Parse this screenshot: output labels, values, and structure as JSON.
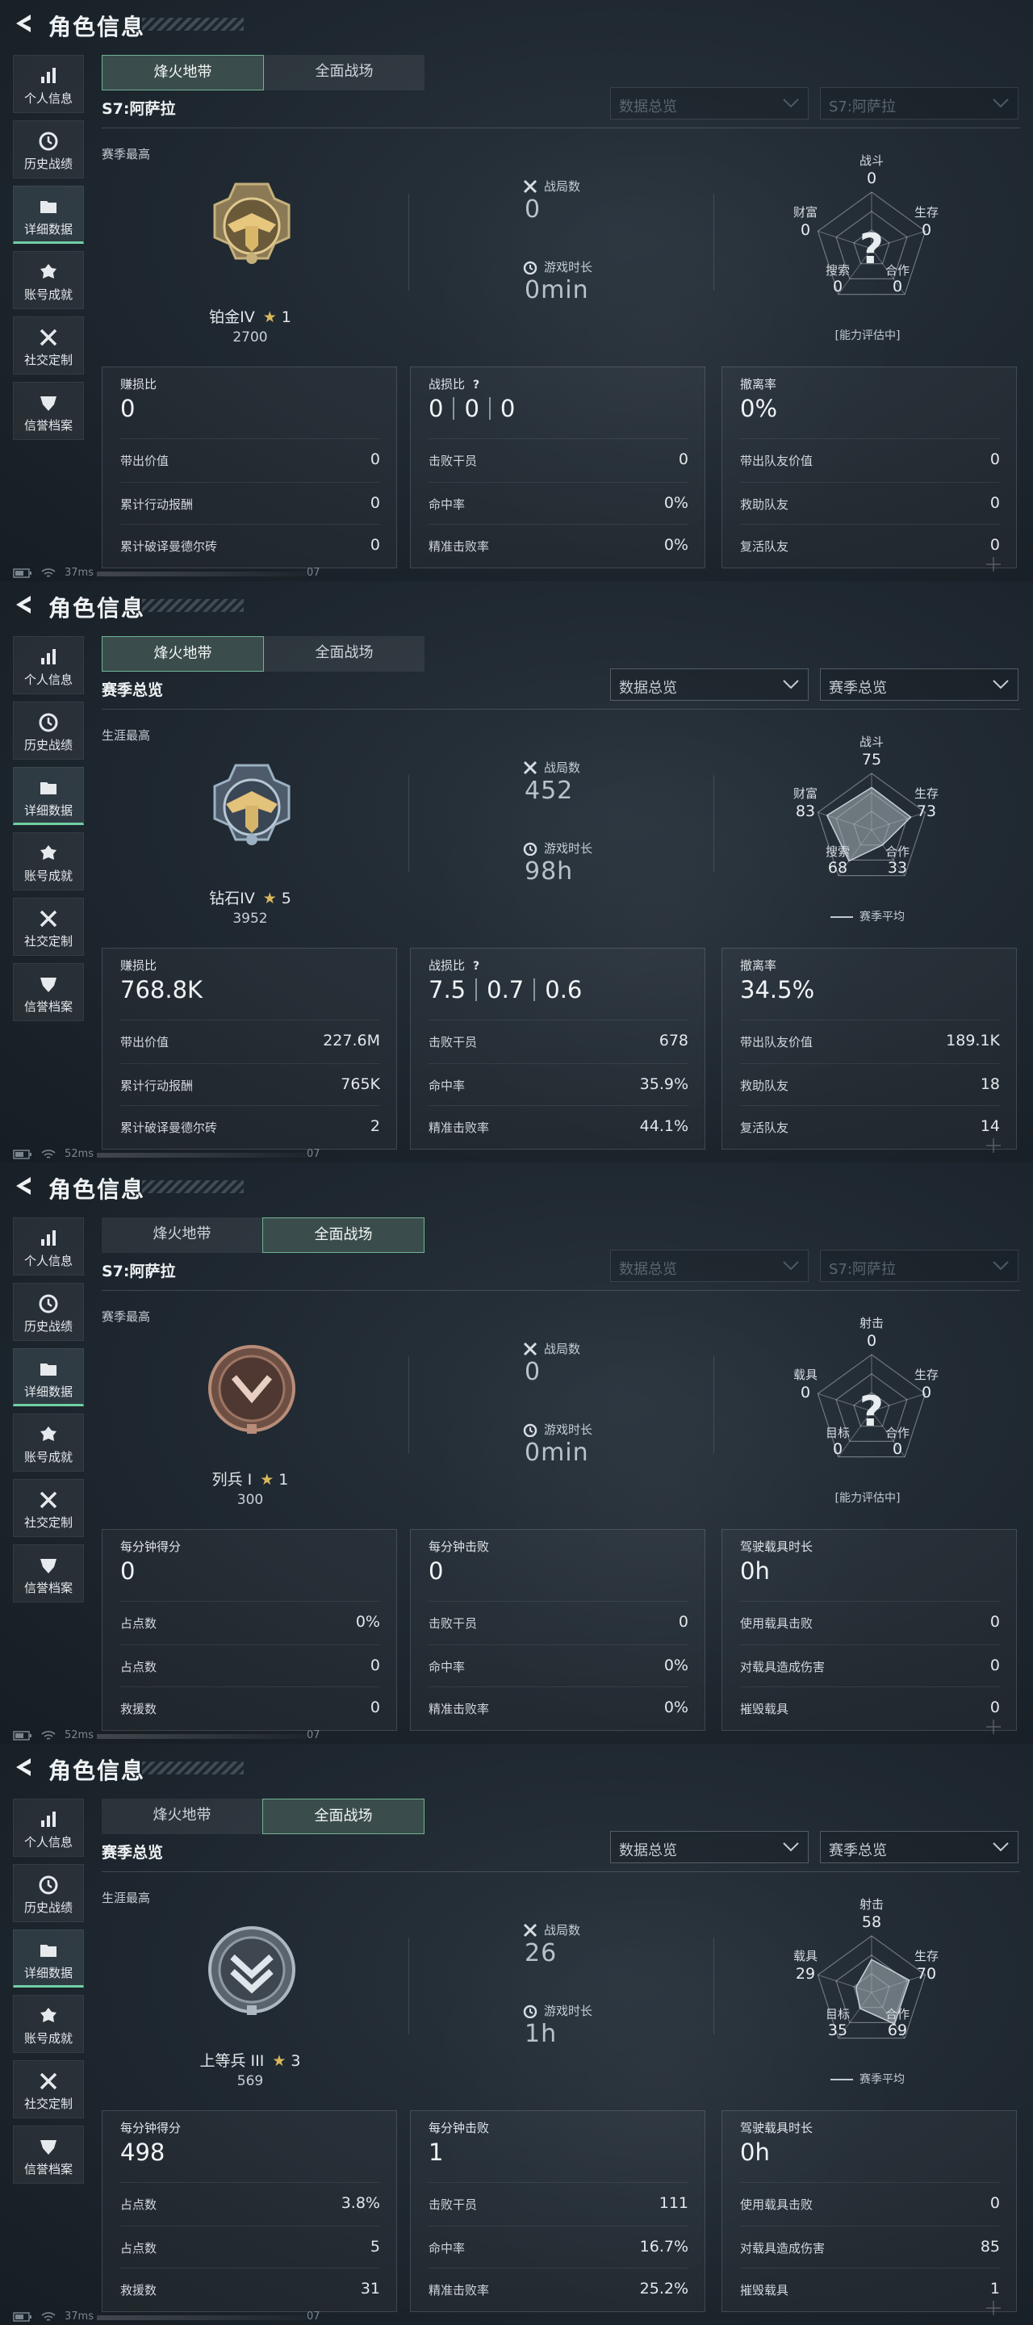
{
  "panels": [
    {
      "header_title": "角色信息",
      "sidebar": [
        "个人信息",
        "历史战绩",
        "详细数据",
        "账号成就",
        "社交定制",
        "信誉档案"
      ],
      "tabs": [
        "烽火地带",
        "全面战场"
      ],
      "active_tab": 0,
      "season_label": "S7:阿萨拉",
      "dropdowns": [
        "数据总览",
        "S7:阿萨拉"
      ],
      "dropdowns_dimmed": true,
      "best_label": "赛季最高",
      "rank_name": "铂金IV",
      "rank_stars": "1",
      "rank_score": "2700",
      "badge_type": "platinum-badge",
      "stat1_label": "战局数",
      "stat1_value": "0",
      "stat2_label": "游戏时长",
      "stat2_value": "0min",
      "radar": {
        "labels": [
          "战斗",
          "生存",
          "合作",
          "搜索",
          "财富"
        ],
        "values": [
          "0",
          "0",
          "0",
          "0",
          "0"
        ],
        "levels": [
          0,
          0,
          0,
          0,
          0
        ],
        "unknown": true,
        "note": "[能力评估中]"
      },
      "cards": [
        {
          "label": "赚损比",
          "value": "0",
          "rows": [
            [
              "带出价值",
              "0"
            ],
            [
              "累计行动报酬",
              "0"
            ],
            [
              "累计破译曼德尔砖",
              "0"
            ]
          ]
        },
        {
          "label": "战损比",
          "ratios": [
            "0",
            "0",
            "0"
          ],
          "help": "?",
          "rows": [
            [
              "击败干员",
              "0"
            ],
            [
              "命中率",
              "0%"
            ],
            [
              "精准击败率",
              "0%"
            ]
          ]
        },
        {
          "label": "撤离率",
          "value": "0%",
          "rows": [
            [
              "带出队友价值",
              "0"
            ],
            [
              "救助队友",
              "0"
            ],
            [
              "复活队友",
              "0"
            ]
          ]
        }
      ],
      "status_ping": "37ms",
      "status_page": "07"
    },
    {
      "header_title": "角色信息",
      "sidebar": [
        "个人信息",
        "历史战绩",
        "详细数据",
        "账号成就",
        "社交定制",
        "信誉档案"
      ],
      "tabs": [
        "烽火地带",
        "全面战场"
      ],
      "active_tab": 0,
      "season_label": "赛季总览",
      "dropdowns": [
        "数据总览",
        "赛季总览"
      ],
      "dropdowns_dimmed": false,
      "best_label": "生涯最高",
      "rank_name": "钻石IV",
      "rank_stars": "5",
      "rank_score": "3952",
      "badge_type": "diamond-badge",
      "stat1_label": "战局数",
      "stat1_value": "452",
      "stat2_label": "游戏时长",
      "stat2_value": "98h",
      "radar": {
        "labels": [
          "战斗",
          "生存",
          "合作",
          "搜索",
          "财富"
        ],
        "values": [
          "75",
          "73",
          "33",
          "68",
          "83"
        ],
        "levels": [
          0.75,
          0.73,
          0.33,
          0.68,
          0.83
        ],
        "unknown": false,
        "note": "赛季平均"
      },
      "cards": [
        {
          "label": "赚损比",
          "value": "768.8K",
          "rows": [
            [
              "带出价值",
              "227.6M"
            ],
            [
              "累计行动报酬",
              "765K"
            ],
            [
              "累计破译曼德尔砖",
              "2"
            ]
          ]
        },
        {
          "label": "战损比",
          "ratios": [
            "7.5",
            "0.7",
            "0.6"
          ],
          "help": "?",
          "rows": [
            [
              "击败干员",
              "678"
            ],
            [
              "命中率",
              "35.9%"
            ],
            [
              "精准击败率",
              "44.1%"
            ]
          ]
        },
        {
          "label": "撤离率",
          "value": "34.5%",
          "rows": [
            [
              "带出队友价值",
              "189.1K"
            ],
            [
              "救助队友",
              "18"
            ],
            [
              "复活队友",
              "14"
            ]
          ]
        }
      ],
      "status_ping": "52ms",
      "status_page": "07"
    },
    {
      "header_title": "角色信息",
      "sidebar": [
        "个人信息",
        "历史战绩",
        "详细数据",
        "账号成就",
        "社交定制",
        "信誉档案"
      ],
      "tabs": [
        "烽火地带",
        "全面战场"
      ],
      "active_tab": 1,
      "season_label": "S7:阿萨拉",
      "dropdowns": [
        "数据总览",
        "S7:阿萨拉"
      ],
      "dropdowns_dimmed": true,
      "best_label": "赛季最高",
      "rank_name": "列兵 I",
      "rank_stars": "1",
      "rank_score": "300",
      "badge_type": "private-badge",
      "stat1_label": "战局数",
      "stat1_value": "0",
      "stat2_label": "游戏时长",
      "stat2_value": "0min",
      "radar": {
        "labels": [
          "射击",
          "生存",
          "合作",
          "目标",
          "载具"
        ],
        "values": [
          "0",
          "0",
          "0",
          "0",
          "0"
        ],
        "levels": [
          0,
          0,
          0,
          0,
          0
        ],
        "unknown": true,
        "note": "[能力评估中]"
      },
      "cards": [
        {
          "label": "每分钟得分",
          "value": "0",
          "rows": [
            [
              "占点数",
              "0%"
            ],
            [
              "占点数",
              "0"
            ],
            [
              "救援数",
              "0"
            ]
          ]
        },
        {
          "label": "每分钟击败",
          "value": "0",
          "rows": [
            [
              "击败干员",
              "0"
            ],
            [
              "命中率",
              "0%"
            ],
            [
              "精准击败率",
              "0%"
            ]
          ]
        },
        {
          "label": "驾驶载具时长",
          "value": "0h",
          "rows": [
            [
              "使用载具击败",
              "0"
            ],
            [
              "对载具造成伤害",
              "0"
            ],
            [
              "摧毁载具",
              "0"
            ]
          ]
        }
      ],
      "status_ping": "52ms",
      "status_page": "07"
    },
    {
      "header_title": "角色信息",
      "sidebar": [
        "个人信息",
        "历史战绩",
        "详细数据",
        "账号成就",
        "社交定制",
        "信誉档案"
      ],
      "tabs": [
        "烽火地带",
        "全面战场"
      ],
      "active_tab": 1,
      "season_label": "赛季总览",
      "dropdowns": [
        "数据总览",
        "赛季总览"
      ],
      "dropdowns_dimmed": false,
      "best_label": "生涯最高",
      "rank_name": "上等兵 III",
      "rank_stars": "3",
      "rank_score": "569",
      "badge_type": "corporal-badge",
      "stat1_label": "战局数",
      "stat1_value": "26",
      "stat2_label": "游戏时长",
      "stat2_value": "1h",
      "radar": {
        "labels": [
          "射击",
          "生存",
          "合作",
          "目标",
          "载具"
        ],
        "values": [
          "58",
          "70",
          "69",
          "35",
          "29"
        ],
        "levels": [
          0.58,
          0.7,
          0.69,
          0.35,
          0.29
        ],
        "unknown": false,
        "note": "赛季平均"
      },
      "cards": [
        {
          "label": "每分钟得分",
          "value": "498",
          "rows": [
            [
              "占点数",
              "3.8%"
            ],
            [
              "占点数",
              "5"
            ],
            [
              "救援数",
              "31"
            ]
          ]
        },
        {
          "label": "每分钟击败",
          "value": "1",
          "rows": [
            [
              "击败干员",
              "111"
            ],
            [
              "命中率",
              "16.7%"
            ],
            [
              "精准击败率",
              "25.2%"
            ]
          ]
        },
        {
          "label": "驾驶载具时长",
          "value": "0h",
          "rows": [
            [
              "使用载具击败",
              "0"
            ],
            [
              "对载具造成伤害",
              "85"
            ],
            [
              "摧毁载具",
              "1"
            ]
          ]
        }
      ],
      "status_ping": "37ms",
      "status_page": "07"
    }
  ]
}
